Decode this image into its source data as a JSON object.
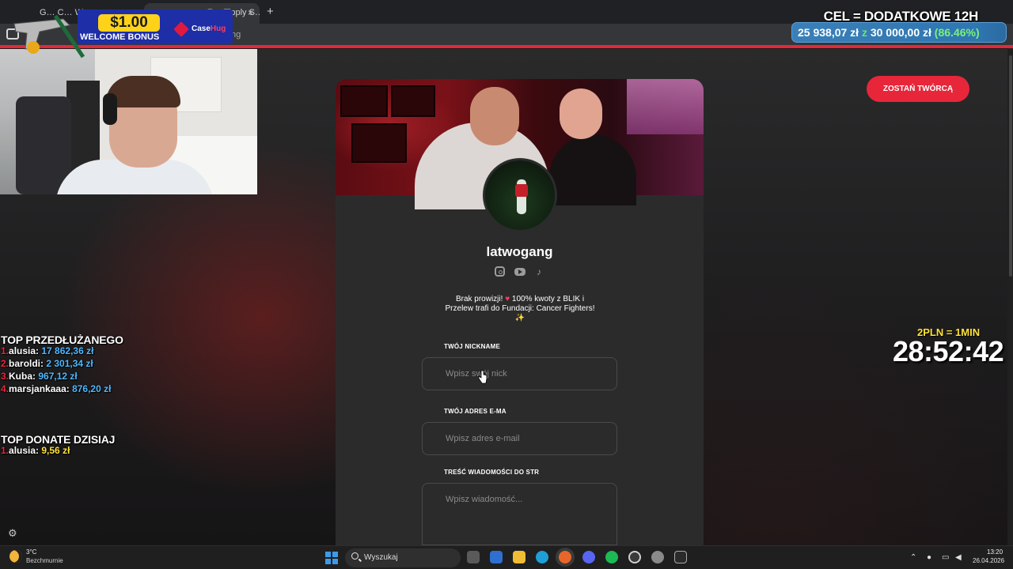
{
  "browser": {
    "tabs": [
      {
        "label": "G…  C…  W…"
      },
      {
        "label": "Z…  Tipply S…"
      }
    ],
    "new_tab": "+",
    "tab_close": "×",
    "url_fragment": "ng"
  },
  "promo": {
    "amount": "$1.00",
    "subtitle": "WELCOME BONUS",
    "brand_a": "Case",
    "brand_b": "Hug"
  },
  "goal": {
    "title": "CEL = DODATKOWE 12H",
    "current": "25 938,07 zł",
    "sep": "z",
    "target": "30 000,00 zł",
    "percent": "(86.46%)",
    "progress": 0.8646
  },
  "leaderboard_extended": {
    "title": "TOP PRZEDŁUŻANEGO",
    "rows": [
      {
        "rank": "1.",
        "name": "alusia:",
        "value": "17 862,36 zł"
      },
      {
        "rank": "2.",
        "name": "baroldi:",
        "value": "2 301,34 zł"
      },
      {
        "rank": "3.",
        "name": "Kuba:",
        "value": "967,12 zł"
      },
      {
        "rank": "4.",
        "name": "marsjankaaa:",
        "value": "876,20 zł"
      }
    ]
  },
  "leaderboard_today": {
    "title": "TOP DONATE DZISIAJ",
    "rows": [
      {
        "rank": "1.",
        "name": "alusia:",
        "value": "9,56 zł"
      }
    ]
  },
  "timer": {
    "rate": "2PLN = 1MIN",
    "value": "28:52:42"
  },
  "cta": {
    "label": "ZOSTAŃ TWÓRCĄ"
  },
  "profile": {
    "name": "latwogang",
    "description_a": "Brak prowizji! ",
    "heart": "♥",
    "description_b": " 100% kwoty z BLIK i Przelew trafi do Fundacji: Cancer Fighters! ✨",
    "social_icons": [
      "instagram-icon",
      "youtube-icon",
      "tiktok-icon"
    ]
  },
  "form": {
    "nickname_label": "TWÓJ NICKNAME",
    "nickname_placeholder": "Wpisz swój nick",
    "email_label": "TWÓJ ADRES E-MA",
    "email_placeholder": "Wpisz adres e-mail",
    "message_label": "TREŚĆ WIADOMOŚCI DO STR",
    "message_placeholder": "Wpisz wiadomość..."
  },
  "taskbar": {
    "temp": "3°C",
    "weather": "Bezchmurnie",
    "search": "Wyszukaj",
    "time": "13:20",
    "date": "26.04.2026"
  },
  "colors": {
    "accent": "#e8263a",
    "card": "#2b2b2c",
    "goal_green": "#6ee36e",
    "leader_blue": "#4fb8ff",
    "leader_yellow": "#ffe23a"
  }
}
